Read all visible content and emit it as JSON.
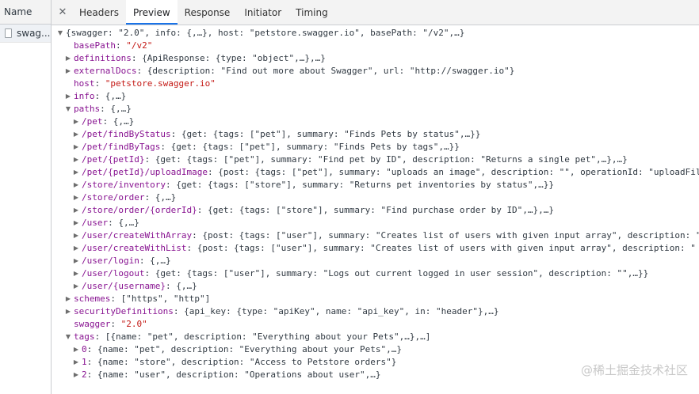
{
  "network_list": {
    "header": "Name",
    "requests": [
      {
        "name": "swag..."
      }
    ]
  },
  "detail_tabs": {
    "close_glyph": "✕",
    "tabs": [
      "Headers",
      "Preview",
      "Response",
      "Initiator",
      "Timing"
    ],
    "active": "Preview"
  },
  "preview": {
    "lines": [
      {
        "indent": 0,
        "arrow": "down",
        "key": "",
        "summary": "{swagger: \"2.0\", info: {,…}, host: \"petstore.swagger.io\", basePath: \"/v2\",…}"
      },
      {
        "indent": 1,
        "arrow": "none",
        "key": "basePath",
        "value": "\"/v2\""
      },
      {
        "indent": 1,
        "arrow": "right",
        "key": "definitions",
        "summary": "{ApiResponse: {type: \"object\",…},…}"
      },
      {
        "indent": 1,
        "arrow": "right",
        "key": "externalDocs",
        "summary": "{description: \"Find out more about Swagger\", url: \"http://swagger.io\"}"
      },
      {
        "indent": 1,
        "arrow": "none",
        "key": "host",
        "value": "\"petstore.swagger.io\""
      },
      {
        "indent": 1,
        "arrow": "right",
        "key": "info",
        "summary": "{,…}"
      },
      {
        "indent": 1,
        "arrow": "down",
        "key": "paths",
        "summary": "{,…}"
      },
      {
        "indent": 2,
        "arrow": "right",
        "key": "/pet",
        "summary": "{,…}"
      },
      {
        "indent": 2,
        "arrow": "right",
        "key": "/pet/findByStatus",
        "summary": "{get: {tags: [\"pet\"], summary: \"Finds Pets by status\",…}}"
      },
      {
        "indent": 2,
        "arrow": "right",
        "key": "/pet/findByTags",
        "summary": "{get: {tags: [\"pet\"], summary: \"Finds Pets by tags\",…}}"
      },
      {
        "indent": 2,
        "arrow": "right",
        "key": "/pet/{petId}",
        "summary": "{get: {tags: [\"pet\"], summary: \"Find pet by ID\", description: \"Returns a single pet\",…},…}"
      },
      {
        "indent": 2,
        "arrow": "right",
        "key": "/pet/{petId}/uploadImage",
        "summary": "{post: {tags: [\"pet\"], summary: \"uploads an image\", description: \"\", operationId: \"uploadFil"
      },
      {
        "indent": 2,
        "arrow": "right",
        "key": "/store/inventory",
        "summary": "{get: {tags: [\"store\"], summary: \"Returns pet inventories by status\",…}}"
      },
      {
        "indent": 2,
        "arrow": "right",
        "key": "/store/order",
        "summary": "{,…}"
      },
      {
        "indent": 2,
        "arrow": "right",
        "key": "/store/order/{orderId}",
        "summary": "{get: {tags: [\"store\"], summary: \"Find purchase order by ID\",…},…}"
      },
      {
        "indent": 2,
        "arrow": "right",
        "key": "/user",
        "summary": "{,…}"
      },
      {
        "indent": 2,
        "arrow": "right",
        "key": "/user/createWithArray",
        "summary": "{post: {tags: [\"user\"], summary: \"Creates list of users with given input array\", description: \""
      },
      {
        "indent": 2,
        "arrow": "right",
        "key": "/user/createWithList",
        "summary": "{post: {tags: [\"user\"], summary: \"Creates list of users with given input array\", description: \""
      },
      {
        "indent": 2,
        "arrow": "right",
        "key": "/user/login",
        "summary": "{,…}"
      },
      {
        "indent": 2,
        "arrow": "right",
        "key": "/user/logout",
        "summary": "{get: {tags: [\"user\"], summary: \"Logs out current logged in user session\", description: \"\",…}}"
      },
      {
        "indent": 2,
        "arrow": "right",
        "key": "/user/{username}",
        "summary": "{,…}"
      },
      {
        "indent": 1,
        "arrow": "right",
        "key": "schemes",
        "summary": "[\"https\", \"http\"]"
      },
      {
        "indent": 1,
        "arrow": "right",
        "key": "securityDefinitions",
        "summary": "{api_key: {type: \"apiKey\", name: \"api_key\", in: \"header\"},…}"
      },
      {
        "indent": 1,
        "arrow": "none",
        "key": "swagger",
        "value": "\"2.0\""
      },
      {
        "indent": 1,
        "arrow": "down",
        "key": "tags",
        "summary": "[{name: \"pet\", description: \"Everything about your Pets\",…},…]"
      },
      {
        "indent": 2,
        "arrow": "right",
        "key": "0",
        "summary": "{name: \"pet\", description: \"Everything about your Pets\",…}"
      },
      {
        "indent": 2,
        "arrow": "right",
        "key": "1",
        "summary": "{name: \"store\", description: \"Access to Petstore orders\"}"
      },
      {
        "indent": 2,
        "arrow": "right",
        "key": "2",
        "summary": "{name: \"user\", description: \"Operations about user\",…}"
      }
    ]
  },
  "watermark": "@稀土掘金技术社区",
  "colors": {
    "key": "#881391",
    "string": "#c41a16",
    "accent": "#1a73e8"
  }
}
